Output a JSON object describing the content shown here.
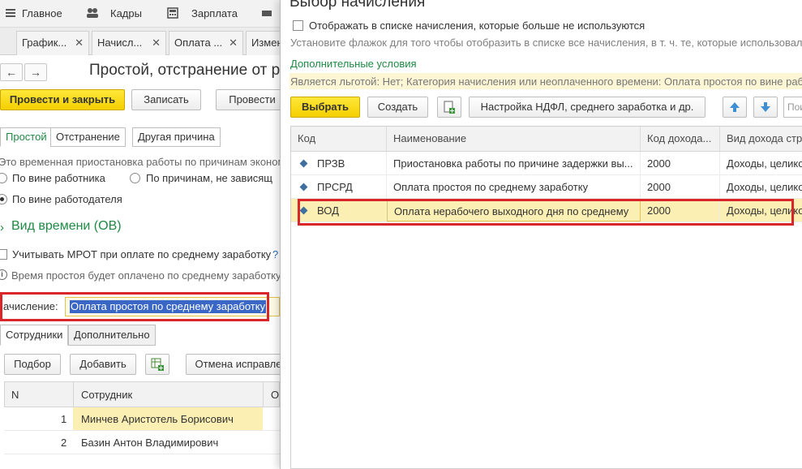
{
  "topbar": {
    "items": [
      {
        "label": "Главное",
        "icon": "menu-icon"
      },
      {
        "label": "Кадры",
        "icon": "people-icon"
      },
      {
        "label": "Зарплата",
        "icon": "calculator-icon"
      }
    ]
  },
  "tabs": [
    {
      "label": "График..."
    },
    {
      "label": "Начисл..."
    },
    {
      "label": "Оплата ..."
    },
    {
      "label": "Измен"
    }
  ],
  "form": {
    "title": "Простой, отстранение от р",
    "post_close_label": "Провести и закрыть",
    "save_label": "Записать",
    "post_label": "Провести",
    "segments": [
      "Простой",
      "Отстранение",
      "Другая причина"
    ],
    "description": "Это временная приостановка работы по причинам экономи",
    "radio_employee": "По вине работника",
    "radio_independent": "По причинам, не зависящ",
    "radio_employer": "По вине работодателя",
    "time_type_label": "Вид времени (ОВ)",
    "mrot_label": "Учитывать МРОТ при оплате по среднему заработку",
    "mrot_help": "?",
    "info_text": "Время простоя будет оплачено по среднему заработку",
    "accrual_label": "ачисление:",
    "accrual_value": "Оплата простоя по среднему заработку",
    "bottom_tabs": [
      "Сотрудники",
      "Дополнительно"
    ],
    "pick_label": "Подбор",
    "add_label": "Добавить",
    "cancel_fix_label": "Отмена исправле",
    "table": {
      "headers": [
        "N",
        "Сотрудник",
        "О"
      ],
      "rows": [
        {
          "n": "1",
          "name": "Минчев Аристотель Борисович"
        },
        {
          "n": "2",
          "name": "Базин Антон Владимирович"
        }
      ]
    }
  },
  "dialog": {
    "title": "Выбор начисления",
    "show_unused_label": "Отображать в списке начисления, которые больше не используются",
    "hint": "Установите флажок для того чтобы отобразить в списке все начисления, в т. ч. те, которые использовались",
    "extra_conditions_link": "Дополнительные условия",
    "filter_text": "Является льготой: Нет; Категория начисления или неоплаченного времени: Оплата простоя по вине работодателя",
    "select_label": "Выбрать",
    "create_label": "Создать",
    "settings_label": "Настройка НДФЛ, среднего заработка и др.",
    "search_placeholder": "Поиск",
    "grid": {
      "headers": [
        "Код",
        "Наименование",
        "Код дохода...",
        "Вид дохода стр"
      ],
      "rows": [
        {
          "code": "ПРЗВ",
          "name": "Приостановка работы по причине задержки вы...",
          "income_code": "2000",
          "income_type": "Доходы, целико"
        },
        {
          "code": "ПРСРД",
          "name": "Оплата простоя по среднему заработку",
          "income_code": "2000",
          "income_type": "Доходы, целико"
        },
        {
          "code": "ВОД",
          "name": "Оплата нерабочего выходного дня по среднему",
          "income_code": "2000",
          "income_type": "Доходы, целико"
        }
      ],
      "selected_row": 2
    }
  },
  "colors": {
    "accent_yellow": "#f4d000",
    "highlight_red": "#d9262a",
    "link_green": "#1e8a44",
    "selection_blue": "#3a66c5",
    "selected_row": "#fcefb3"
  }
}
